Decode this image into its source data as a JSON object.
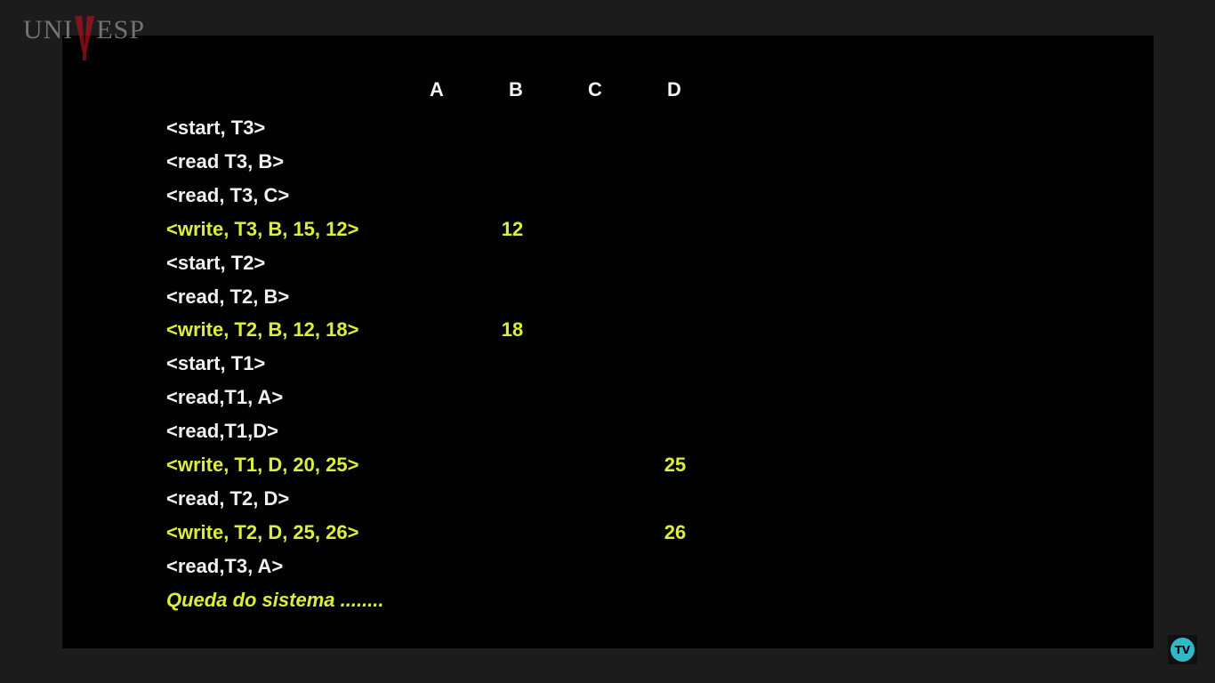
{
  "branding": {
    "logo_left": "UNI",
    "logo_right": "ESP",
    "tv_badge": "TV"
  },
  "columns": [
    "A",
    "B",
    "C",
    "D"
  ],
  "log": [
    {
      "text": "<start, T3>",
      "highlight": false
    },
    {
      "text": "<read T3, B>",
      "highlight": false
    },
    {
      "text": "<read, T3, C>",
      "highlight": false
    },
    {
      "text": "<write, T3, B, 15, 12>",
      "highlight": true
    },
    {
      "text": "<start, T2>",
      "highlight": false
    },
    {
      "text": "<read, T2, B>",
      "highlight": false
    },
    {
      "text": "<write, T2, B, 12, 18>",
      "highlight": true
    },
    {
      "text": "<start, T1>",
      "highlight": false
    },
    {
      "text": "<read,T1, A>",
      "highlight": false
    },
    {
      "text": "<read,T1,D>",
      "highlight": false
    },
    {
      "text": "<write, T1, D, 20, 25>",
      "highlight": true
    },
    {
      "text": "<read, T2, D>",
      "highlight": false
    },
    {
      "text": "<write, T2, D, 25, 26>",
      "highlight": true
    },
    {
      "text": "<read,T3, A>",
      "highlight": false
    }
  ],
  "values": [
    {
      "row": 3,
      "column": "B",
      "value": "12"
    },
    {
      "row": 6,
      "column": "B",
      "value": "18"
    },
    {
      "row": 10,
      "column": "D",
      "value": "25"
    },
    {
      "row": 12,
      "column": "D",
      "value": "26"
    }
  ],
  "footer_note": "Queda do sistema ........",
  "colors": {
    "background": "#1c1c1c",
    "slide": "#030203",
    "text": "#f0f0f0",
    "highlight": "#dcee3a",
    "logo_accent": "#b01020",
    "tv_accent": "#2fb8c8"
  }
}
